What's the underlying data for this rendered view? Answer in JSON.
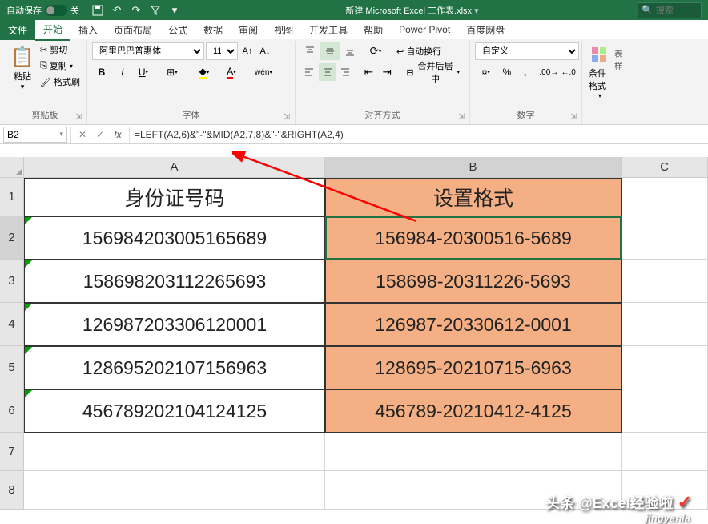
{
  "title_bar": {
    "autosave": "自动保存",
    "autosave_state": "关",
    "filename": "新建 Microsoft Excel 工作表.xlsx",
    "search_placeholder": "搜索"
  },
  "tabs": {
    "file": "文件",
    "home": "开始",
    "insert": "插入",
    "layout": "页面布局",
    "formulas": "公式",
    "data": "数据",
    "review": "审阅",
    "view": "视图",
    "developer": "开发工具",
    "help": "帮助",
    "powerpivot": "Power Pivot",
    "baidu": "百度网盘"
  },
  "ribbon": {
    "clipboard": {
      "paste": "粘贴",
      "cut": "剪切",
      "copy": "复制",
      "format_painter": "格式刷",
      "label": "剪贴板"
    },
    "font": {
      "name": "阿里巴巴普惠体",
      "size": "11",
      "label": "字体"
    },
    "alignment": {
      "wrap": "自动换行",
      "merge": "合并后居中",
      "label": "对齐方式"
    },
    "number": {
      "format": "自定义",
      "label": "数字"
    },
    "styles": {
      "conditional": "条件格式",
      "table": "表样",
      "label": ""
    }
  },
  "formula_bar": {
    "cell_ref": "B2",
    "formula": "=LEFT(A2,6)&\"-\"&MID(A2,7,8)&\"-\"&RIGHT(A2,4)"
  },
  "columns": {
    "a": "A",
    "b": "B",
    "c": "C"
  },
  "headers": {
    "a": "身份证号码",
    "b": "设置格式"
  },
  "rows": [
    {
      "n": "1"
    },
    {
      "n": "2",
      "a": "156984203005165689",
      "b": "156984-20300516-5689"
    },
    {
      "n": "3",
      "a": "158698203112265693",
      "b": "158698-20311226-5693"
    },
    {
      "n": "4",
      "a": "126987203306120001",
      "b": "126987-20330612-0001"
    },
    {
      "n": "5",
      "a": "128695202107156963",
      "b": "128695-20210715-6963"
    },
    {
      "n": "6",
      "a": "456789202104124125",
      "b": "456789-20210412-4125"
    },
    {
      "n": "7"
    },
    {
      "n": "8"
    }
  ],
  "watermark": {
    "line1": "头条 @Excel经验啦",
    "line2": "jingyanla"
  }
}
